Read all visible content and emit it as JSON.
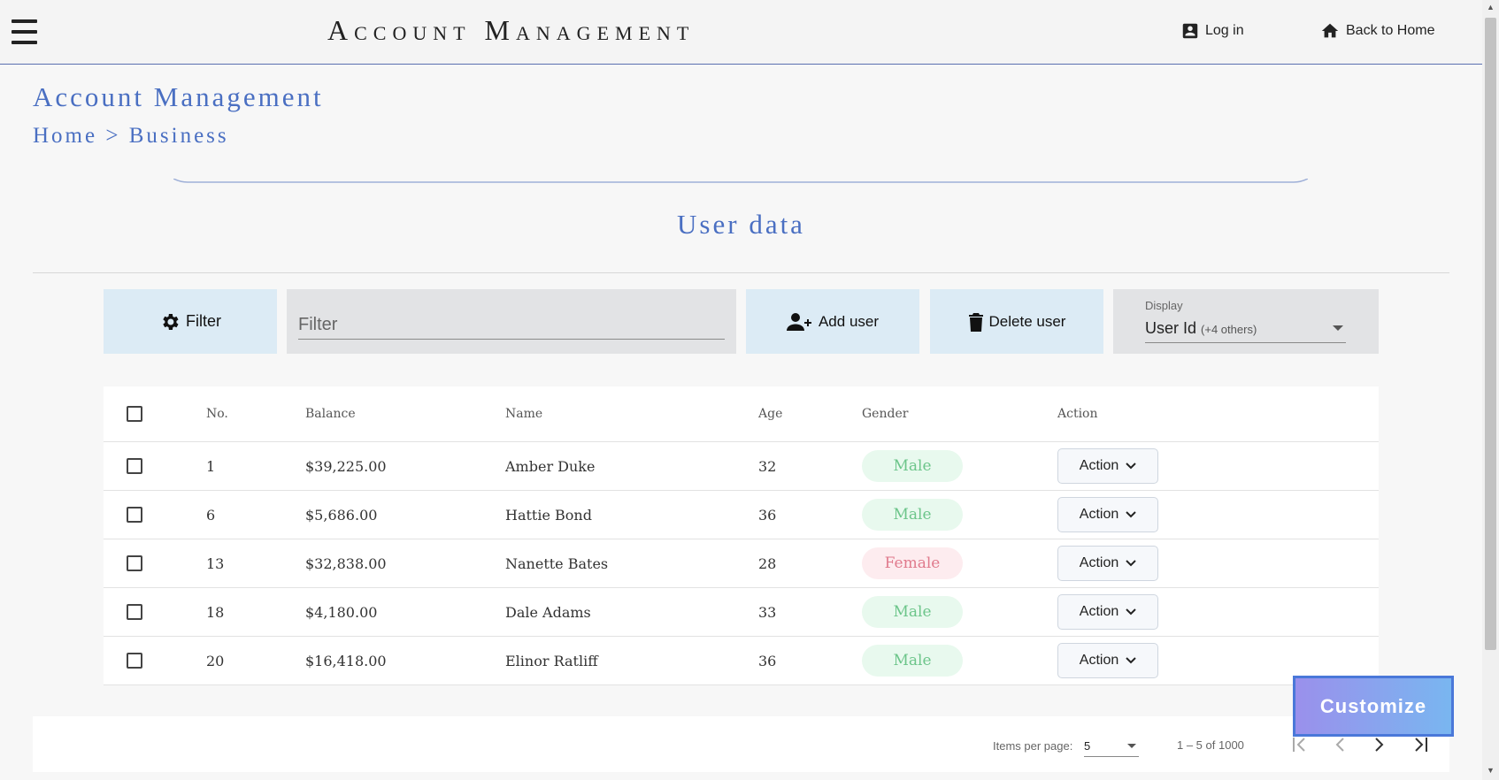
{
  "topbar": {
    "title": "Account Management",
    "login_label": "Log in",
    "home_label": "Back to Home"
  },
  "page": {
    "heading": "Account Management",
    "breadcrumb": {
      "home": "Home",
      "separator": ">",
      "current": "Business"
    },
    "section_title": "User data"
  },
  "toolbar": {
    "filter_button": "Filter",
    "filter_placeholder": "Filter",
    "add_user": "Add user",
    "delete_user": "Delete user",
    "display_label": "Display",
    "display_value": "User Id",
    "display_extra": "(+4 others)"
  },
  "table": {
    "headers": {
      "no": "No.",
      "balance": "Balance",
      "name": "Name",
      "age": "Age",
      "gender": "Gender",
      "action": "Action"
    },
    "action_label": "Action",
    "rows": [
      {
        "no": "1",
        "balance": "$39,225.00",
        "name": "Amber Duke",
        "age": "32",
        "gender": "Male"
      },
      {
        "no": "6",
        "balance": "$5,686.00",
        "name": "Hattie Bond",
        "age": "36",
        "gender": "Male"
      },
      {
        "no": "13",
        "balance": "$32,838.00",
        "name": "Nanette Bates",
        "age": "28",
        "gender": "Female"
      },
      {
        "no": "18",
        "balance": "$4,180.00",
        "name": "Dale Adams",
        "age": "33",
        "gender": "Male"
      },
      {
        "no": "20",
        "balance": "$16,418.00",
        "name": "Elinor Ratliff",
        "age": "36",
        "gender": "Male"
      }
    ]
  },
  "paginator": {
    "items_per_page_label": "Items per page:",
    "items_per_page_value": "5",
    "range": "1 – 5 of 1000"
  },
  "customize_label": "Customize",
  "colors": {
    "accent": "#4a6fc2",
    "button_bg": "#dcebf5",
    "male": "#6cc58a",
    "female": "#e07a8c"
  }
}
